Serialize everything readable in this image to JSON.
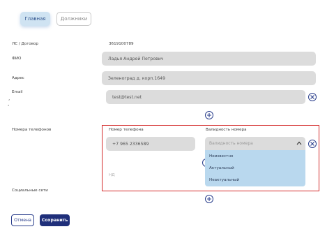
{
  "tabs": {
    "main": "Главная",
    "positions": "Должники"
  },
  "labels": {
    "ls": "ЛС / Договор",
    "fio": "ФИО",
    "address": "Адрес",
    "email": "Email",
    "phones": "Номера телефонов",
    "social": "Социальные сети"
  },
  "values": {
    "ls": "3619100789",
    "fio": "Ладья Андрей Петрович",
    "address": "Зеленоград д. корп.1649",
    "email": "test@test.net"
  },
  "phones": {
    "col_number": "Номер телефона",
    "col_validity": "Валидность номера",
    "number": "+7 965 2336589",
    "validity_placeholder": "Валидность номера",
    "options": [
      "Неизвестно",
      "Актуальный",
      "Неактуальный"
    ],
    "hint": "НД"
  },
  "buttons": {
    "cancel": "Отмена",
    "save": "Сохранить"
  },
  "icons": {
    "add": "plus-icon",
    "remove": "close-icon",
    "dropdown": "chevron-up-icon"
  },
  "colors": {
    "accent": "#2b3f8c",
    "highlight_border": "#d42a2a",
    "dropdown_bg": "#b9d8ee",
    "field_bg": "#dcdcdc"
  }
}
